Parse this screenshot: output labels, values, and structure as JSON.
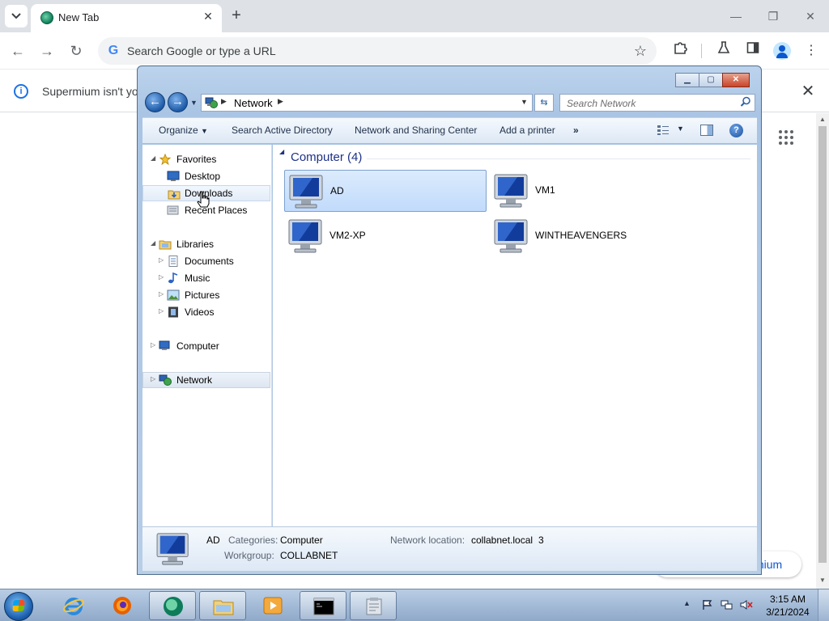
{
  "chrome": {
    "tab_title": "New Tab",
    "tab_close_glyph": "✕",
    "new_tab_glyph": "+",
    "window_minimize": "—",
    "window_restore": "❐",
    "window_close": "✕",
    "omnibox_g": "G",
    "omnibox_placeholder": "Search Google or type a URL",
    "infobar_text": "Supermium isn't you",
    "infobar_close_glyph": "✕",
    "customize_partial_text": "mium"
  },
  "explorer": {
    "address_location": "Network",
    "search_placeholder": "Search Network",
    "commands": {
      "organize": "Organize",
      "search_ad": "Search Active Directory",
      "network_sharing": "Network and Sharing Center",
      "add_printer": "Add a printer",
      "more": "»"
    },
    "help_glyph": "?",
    "nav": {
      "favorites": "Favorites",
      "desktop": "Desktop",
      "downloads": "Downloads",
      "recent_places": "Recent Places",
      "libraries": "Libraries",
      "documents": "Documents",
      "music": "Music",
      "pictures": "Pictures",
      "videos": "Videos",
      "computer": "Computer",
      "network": "Network"
    },
    "group_header": "Computer (4)",
    "items": [
      {
        "label": "AD",
        "selected": true
      },
      {
        "label": "VM1",
        "selected": false
      },
      {
        "label": "VM2-XP",
        "selected": false
      },
      {
        "label": "WINTHEAVENGERS",
        "selected": false
      }
    ],
    "details": {
      "name": "AD",
      "categories_label": "Categories:",
      "categories_value": "Computer",
      "workgroup_label": "Workgroup:",
      "workgroup_value": "COLLABNET",
      "network_location_label": "Network location:",
      "network_location_value": "collabnet.local",
      "network_location_count": "3"
    }
  },
  "taskbar": {
    "time": "3:15 AM",
    "date": "3/21/2024"
  },
  "colors": {
    "win7_selection": "#c1dbfc",
    "group_header": "#1e3287",
    "chrome_tabstrip": "#dee1e6"
  }
}
